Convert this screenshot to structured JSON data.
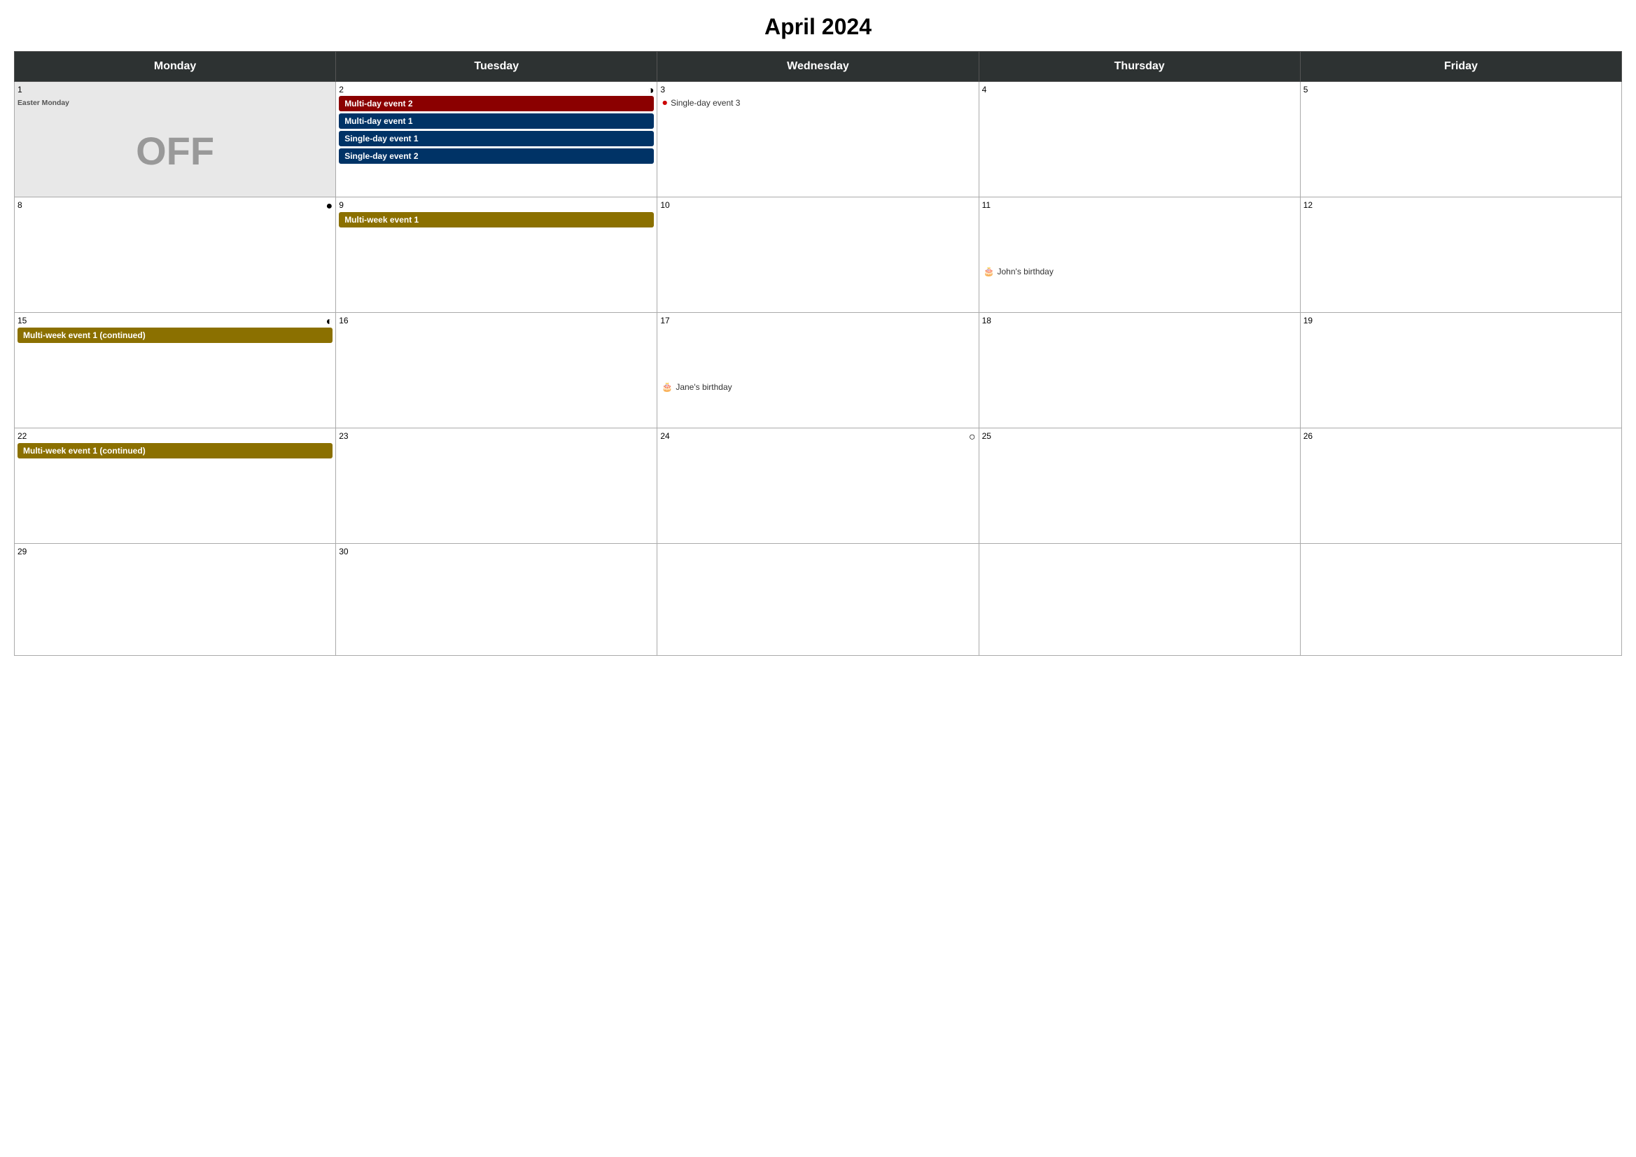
{
  "title": "April 2024",
  "headers": [
    "Monday",
    "Tuesday",
    "Wednesday",
    "Thursday",
    "Friday"
  ],
  "colors": {
    "header_bg": "#2d3232",
    "multiday2": "#8b0000",
    "multiday1": "#003366",
    "multiweek": "#8b7000",
    "off_bg": "#e8e8e8"
  },
  "weeks": [
    {
      "days": [
        {
          "num": "1",
          "label": "Easter Monday",
          "off": true,
          "moon": null
        },
        {
          "num": "2",
          "moon": "half-right",
          "events": []
        },
        {
          "num": "3",
          "events": []
        },
        {
          "num": "4",
          "events": []
        },
        {
          "num": "5",
          "events": []
        }
      ],
      "spanning_events": [
        {
          "type": "multiday2",
          "label": "Multi-day event 2",
          "cols": "2-5"
        },
        {
          "type": "multiday1",
          "label": "Multi-day event 1",
          "cols": "2-3"
        },
        {
          "type": "single",
          "label": "Single-day event 1",
          "col": "2"
        },
        {
          "type": "single",
          "label": "Single-day event 2",
          "col": "2"
        },
        {
          "type": "single-dot",
          "label": "Single-day event 3",
          "col": "3"
        }
      ]
    },
    {
      "days": [
        {
          "num": "8",
          "moon": "full"
        },
        {
          "num": "9"
        },
        {
          "num": "10"
        },
        {
          "num": "11"
        },
        {
          "num": "12"
        }
      ],
      "spanning_events": [
        {
          "type": "multiweek",
          "label": "Multi-week event 1",
          "cols": "2-5"
        }
      ],
      "birthday": {
        "col": 4,
        "label": "John's birthday"
      }
    },
    {
      "days": [
        {
          "num": "15",
          "moon": "half-left"
        },
        {
          "num": "16"
        },
        {
          "num": "17"
        },
        {
          "num": "18"
        },
        {
          "num": "19"
        }
      ],
      "spanning_events": [
        {
          "type": "multiweek",
          "label": "Multi-week event 1 (continued)",
          "cols": "1-5"
        }
      ],
      "birthday": {
        "col": 3,
        "label": "Jane's birthday"
      }
    },
    {
      "days": [
        {
          "num": "22"
        },
        {
          "num": "23"
        },
        {
          "num": "24",
          "moon": "empty"
        },
        {
          "num": "25"
        },
        {
          "num": "26"
        }
      ],
      "spanning_events": [
        {
          "type": "multiweek",
          "label": "Multi-week event 1 (continued)",
          "cols": "1-2"
        }
      ]
    },
    {
      "days": [
        {
          "num": "29"
        },
        {
          "num": "30"
        },
        {
          "num": "",
          "empty": true
        },
        {
          "num": "",
          "empty": true
        },
        {
          "num": "",
          "empty": true
        }
      ],
      "spanning_events": []
    }
  ]
}
